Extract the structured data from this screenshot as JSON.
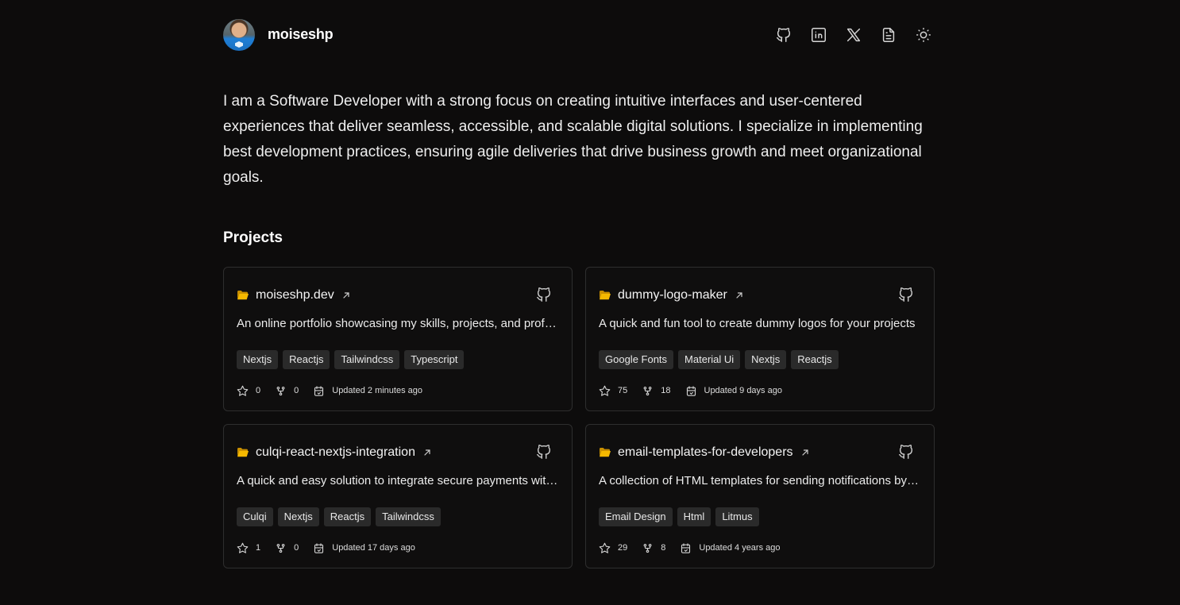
{
  "header": {
    "username": "moiseshp",
    "icons": [
      "github-icon",
      "linkedin-icon",
      "x-icon",
      "resume-icon",
      "sun-icon"
    ]
  },
  "bio": "I am a Software Developer with a strong focus on creating intuitive interfaces and user-centered experiences that deliver seamless, accessible, and scalable digital solutions. I specialize in implementing best development practices, ensuring agile deliveries that drive business growth and meet organizational goals.",
  "projects": {
    "title": "Projects",
    "items": [
      {
        "name": "moiseshp.dev",
        "description": "An online portfolio showcasing my skills, projects, and professional experience",
        "tags": [
          "Nextjs",
          "Reactjs",
          "Tailwindcss",
          "Typescript"
        ],
        "stars": "0",
        "forks": "0",
        "updated": "Updated 2 minutes ago"
      },
      {
        "name": "dummy-logo-maker",
        "description": "A quick and fun tool to create dummy logos for your projects",
        "tags": [
          "Google Fonts",
          "Material Ui",
          "Nextjs",
          "Reactjs"
        ],
        "stars": "75",
        "forks": "18",
        "updated": "Updated 9 days ago"
      },
      {
        "name": "culqi-react-nextjs-integration",
        "description": "A quick and easy solution to integrate secure payments with Culqi",
        "tags": [
          "Culqi",
          "Nextjs",
          "Reactjs",
          "Tailwindcss"
        ],
        "stars": "1",
        "forks": "0",
        "updated": "Updated 17 days ago"
      },
      {
        "name": "email-templates-for-developers",
        "description": "A collection of HTML templates for sending notifications by email",
        "tags": [
          "Email Design",
          "Html",
          "Litmus"
        ],
        "stars": "29",
        "forks": "8",
        "updated": "Updated 4 years ago"
      }
    ]
  },
  "colors": {
    "background": "#0d0c0c",
    "card_border": "#2e2e2e",
    "tag_bg": "#2a2a2a",
    "folder": "#f5b800"
  }
}
